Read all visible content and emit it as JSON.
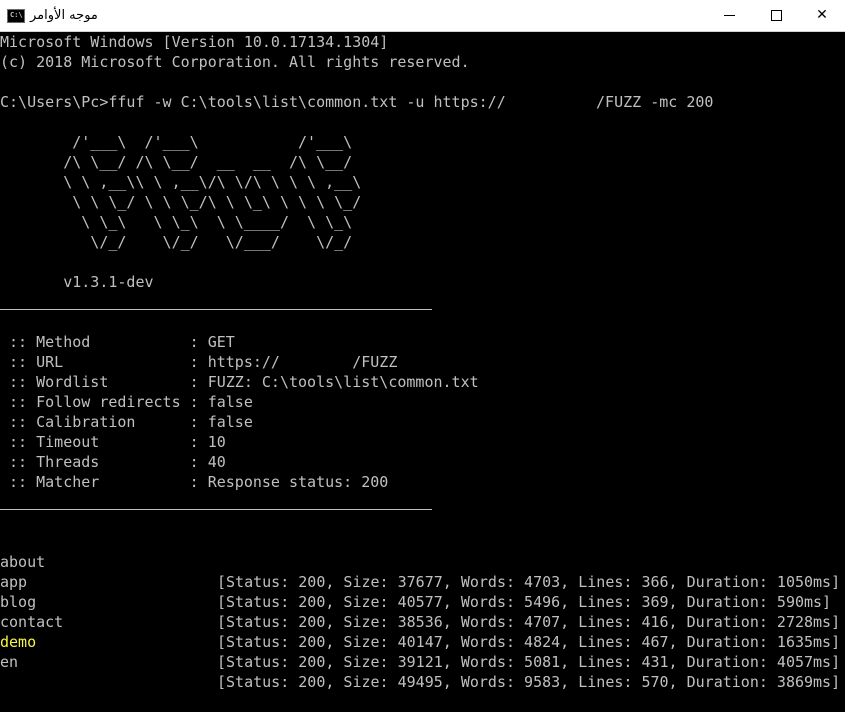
{
  "window": {
    "title": "موجه الأوامر",
    "icon_label": "C:\\",
    "minimize_icon": "minimize-icon",
    "maximize_icon": "maximize-icon",
    "close_glyph": "✕"
  },
  "terminal": {
    "header": [
      "Microsoft Windows [Version 10.0.17134.1304]",
      "(c) 2018 Microsoft Corporation. All rights reserved."
    ],
    "command": "C:\\Users\\Pc>ffuf -w C:\\tools\\list\\common.txt -u https://          /FUZZ -mc 200",
    "banner": [
      "        /'___\\  /'___\\           /'___\\",
      "       /\\ \\__/ /\\ \\__/  __  __  /\\ \\__/",
      "       \\ \\ ,__\\\\ \\ ,__\\/\\ \\/\\ \\ \\ \\ ,__\\",
      "        \\ \\ \\_/ \\ \\ \\_/\\ \\ \\_\\ \\ \\ \\ \\_/",
      "         \\ \\_\\   \\ \\_\\  \\ \\____/  \\ \\_\\",
      "          \\/_/    \\/_/   \\/___/    \\/_/"
    ],
    "version": "       v1.3.1-dev",
    "config": [
      " :: Method           : GET",
      " :: URL              : https://        /FUZZ",
      " :: Wordlist         : FUZZ: C:\\tools\\list\\common.txt",
      " :: Follow redirects : false",
      " :: Calibration      : false",
      " :: Timeout          : 10",
      " :: Threads          : 40",
      " :: Matcher          : Response status: 200"
    ],
    "results": [
      {
        "name": "about",
        "data": "[Status: 200, Size: 37677, Words: 4703, Lines: 366, Duration: 1050ms]",
        "highlight": false
      },
      {
        "name": "app",
        "data": "[Status: 200, Size: 40577, Words: 5496, Lines: 369, Duration: 590ms]",
        "highlight": false
      },
      {
        "name": "blog",
        "data": "[Status: 200, Size: 38536, Words: 4707, Lines: 416, Duration: 2728ms]",
        "highlight": false
      },
      {
        "name": "contact",
        "data": "[Status: 200, Size: 40147, Words: 4824, Lines: 467, Duration: 1635ms]",
        "highlight": false
      },
      {
        "name": "demo",
        "data": "[Status: 200, Size: 39121, Words: 5081, Lines: 431, Duration: 4057ms]",
        "highlight": true
      },
      {
        "name": "en",
        "data": "[Status: 200, Size: 49495, Words: 9583, Lines: 570, Duration: 3869ms]",
        "highlight": false
      }
    ]
  },
  "colors": {
    "background": "#000000",
    "text": "#c0c0c0",
    "highlight": "#f5f543"
  }
}
